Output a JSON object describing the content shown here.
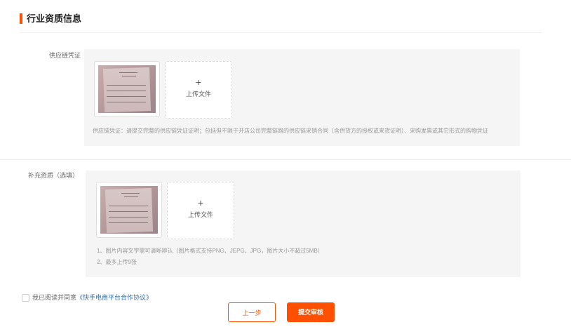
{
  "section": {
    "title": "行业资质信息"
  },
  "supply_chain": {
    "label": "供应链凭证",
    "upload_plus": "+",
    "upload_text": "上传文件",
    "hint": "供应链凭证：请提交完整的供应链凭证证明；包括但不限于开店公司完整链路的供应链采销合同（含供货方的授权或来货证明）、采购发票或其它形式的购物凭证"
  },
  "supplement": {
    "label": "补充资质（选填）",
    "upload_plus": "+",
    "upload_text": "上传文件",
    "hints": [
      "1、图片内容文字需可清晰辨认（图片格式支持PNG、JEPG、JPG，图片大小不超过5MB）",
      "2、最多上传9张"
    ]
  },
  "agreement": {
    "prefix": "我已阅读并同意",
    "link": "《快手电商平台合作协议》",
    "checked": false
  },
  "buttons": {
    "prev": "上一步",
    "submit": "提交审核"
  },
  "colors": {
    "accent": "#fe5000",
    "panel_bg": "#f5f5f5",
    "link": "#3a6ea5"
  }
}
